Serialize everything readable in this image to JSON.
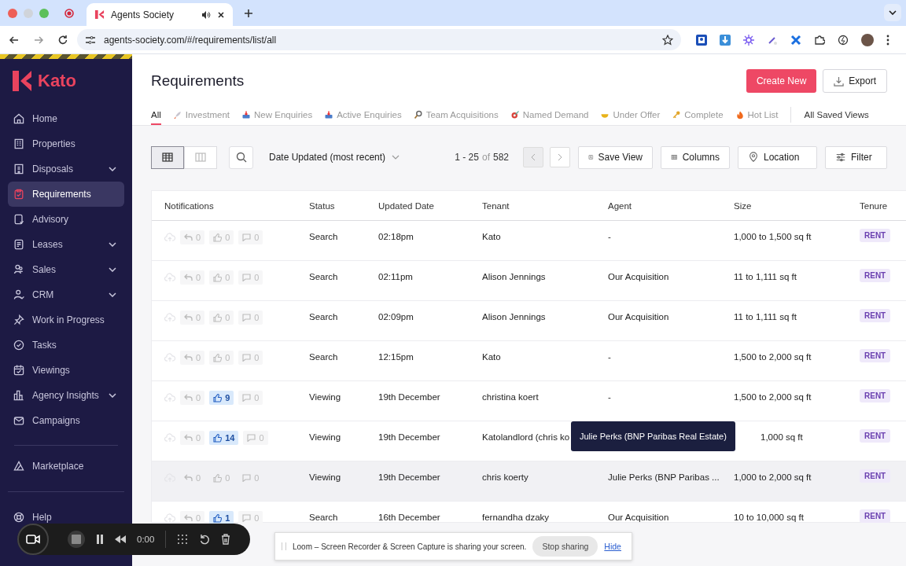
{
  "browser": {
    "tab_title": "Agents Society",
    "url": "agents-society.com/#/requirements/list/all"
  },
  "sidebar": {
    "logo": "Kato",
    "items": [
      {
        "label": "Home",
        "selected": false,
        "expandable": false
      },
      {
        "label": "Properties",
        "selected": false,
        "expandable": false
      },
      {
        "label": "Disposals",
        "selected": false,
        "expandable": true
      },
      {
        "label": "Requirements",
        "selected": true,
        "expandable": false
      },
      {
        "label": "Advisory",
        "selected": false,
        "expandable": false
      },
      {
        "label": "Leases",
        "selected": false,
        "expandable": true
      },
      {
        "label": "Sales",
        "selected": false,
        "expandable": true
      },
      {
        "label": "CRM",
        "selected": false,
        "expandable": true
      },
      {
        "label": "Work in Progress",
        "selected": false,
        "expandable": false
      },
      {
        "label": "Tasks",
        "selected": false,
        "expandable": false
      },
      {
        "label": "Viewings",
        "selected": false,
        "expandable": false
      },
      {
        "label": "Agency Insights",
        "selected": false,
        "expandable": true
      },
      {
        "label": "Campaigns",
        "selected": false,
        "expandable": false
      }
    ],
    "secondary": [
      {
        "label": "Marketplace"
      }
    ],
    "footer": [
      {
        "label": "Help"
      }
    ]
  },
  "page": {
    "title": "Requirements",
    "actions": [
      {
        "label": "Create New",
        "kind": "primary"
      },
      {
        "label": "Export",
        "kind": "export"
      }
    ],
    "tabs": [
      {
        "label": "All",
        "selected": true
      },
      {
        "label": "Investment",
        "selected": false
      },
      {
        "label": "New Enquiries",
        "selected": false
      },
      {
        "label": "Active Enquiries",
        "selected": false
      },
      {
        "label": "Team Acquisitions",
        "selected": false
      },
      {
        "label": "Named Demand",
        "selected": false
      },
      {
        "label": "Under Offer",
        "selected": false
      },
      {
        "label": "Complete",
        "selected": false
      },
      {
        "label": "Hot List",
        "selected": false
      }
    ],
    "saved_views": "All Saved Views"
  },
  "toolbar": {
    "views": [
      {
        "kind": "table",
        "selected": true
      },
      {
        "kind": "board",
        "selected": false
      }
    ],
    "sort": "Date Updated (most recent)",
    "pager": {
      "range": "1 - 25",
      "of": "of",
      "total": "582",
      "prev_disabled": true,
      "next_disabled": false
    },
    "buttons": [
      {
        "label": "Save View",
        "kind": "save"
      },
      {
        "label": "Columns",
        "kind": "columns"
      },
      {
        "label": "Location",
        "kind": "location"
      },
      {
        "label": "Filter",
        "kind": "filter"
      }
    ]
  },
  "table": {
    "columns": [
      "Notifications",
      "Status",
      "Updated Date",
      "Tenant",
      "Agent",
      "Size",
      "Tenure"
    ],
    "rows": [
      {
        "replies": "0",
        "likes": "0",
        "liked": false,
        "comments": "0",
        "status": "Search",
        "updated": "02:18pm",
        "tenant": "Kato",
        "agent": "-",
        "size": "1,000 to 1,500 sq ft",
        "tenure": "RENT",
        "hovered": false
      },
      {
        "replies": "0",
        "likes": "0",
        "liked": false,
        "comments": "0",
        "status": "Search",
        "updated": "02:11pm",
        "tenant": "Alison Jennings",
        "agent": "Our Acquisition",
        "size": "11 to 1,111 sq ft",
        "tenure": "RENT",
        "hovered": false
      },
      {
        "replies": "0",
        "likes": "0",
        "liked": false,
        "comments": "0",
        "status": "Search",
        "updated": "02:09pm",
        "tenant": "Alison Jennings",
        "agent": "Our Acquisition",
        "size": "11 to 1,111 sq ft",
        "tenure": "RENT",
        "hovered": false
      },
      {
        "replies": "0",
        "likes": "0",
        "liked": false,
        "comments": "0",
        "status": "Search",
        "updated": "12:15pm",
        "tenant": "Kato",
        "agent": "-",
        "size": "1,500 to 2,000 sq ft",
        "tenure": "RENT",
        "hovered": false
      },
      {
        "replies": "0",
        "likes": "9",
        "liked": true,
        "comments": "0",
        "status": "Viewing",
        "updated": "19th December",
        "tenant": "christina koert",
        "agent": "-",
        "size": "1,500 to 2,000 sq ft",
        "tenure": "RENT",
        "hovered": false
      },
      {
        "replies": "0",
        "likes": "14",
        "liked": true,
        "comments": "0",
        "status": "Viewing",
        "updated": "19th December",
        "tenant": "Katolandlord (chris ko",
        "size": "1,000 sq ft",
        "tenure": "RENT",
        "hovered": false
      },
      {
        "replies": "0",
        "likes": "0",
        "liked": false,
        "comments": "0",
        "status": "Viewing",
        "updated": "19th December",
        "tenant": "chris koerty",
        "agent": "Julie Perks (BNP Paribas ...",
        "size": "1,000 to 2,000 sq ft",
        "tenure": "RENT",
        "hovered": true
      },
      {
        "replies": "0",
        "likes": "1",
        "liked": true,
        "comments": "0",
        "status": "Search",
        "updated": "16th December",
        "tenant": "fernandha dzaky",
        "agent": "Our Acquisition",
        "size": "10 to 10,000 sq ft",
        "tenure": "RENT",
        "hovered": false
      }
    ]
  },
  "tooltip": "Julie Perks (BNP Paribas Real Estate)",
  "recorder": {
    "time": "0:00"
  },
  "sharing_bar": {
    "message": "Loom – Screen Recorder & Screen Capture is sharing your screen.",
    "stop": "Stop sharing",
    "hide": "Hide"
  }
}
